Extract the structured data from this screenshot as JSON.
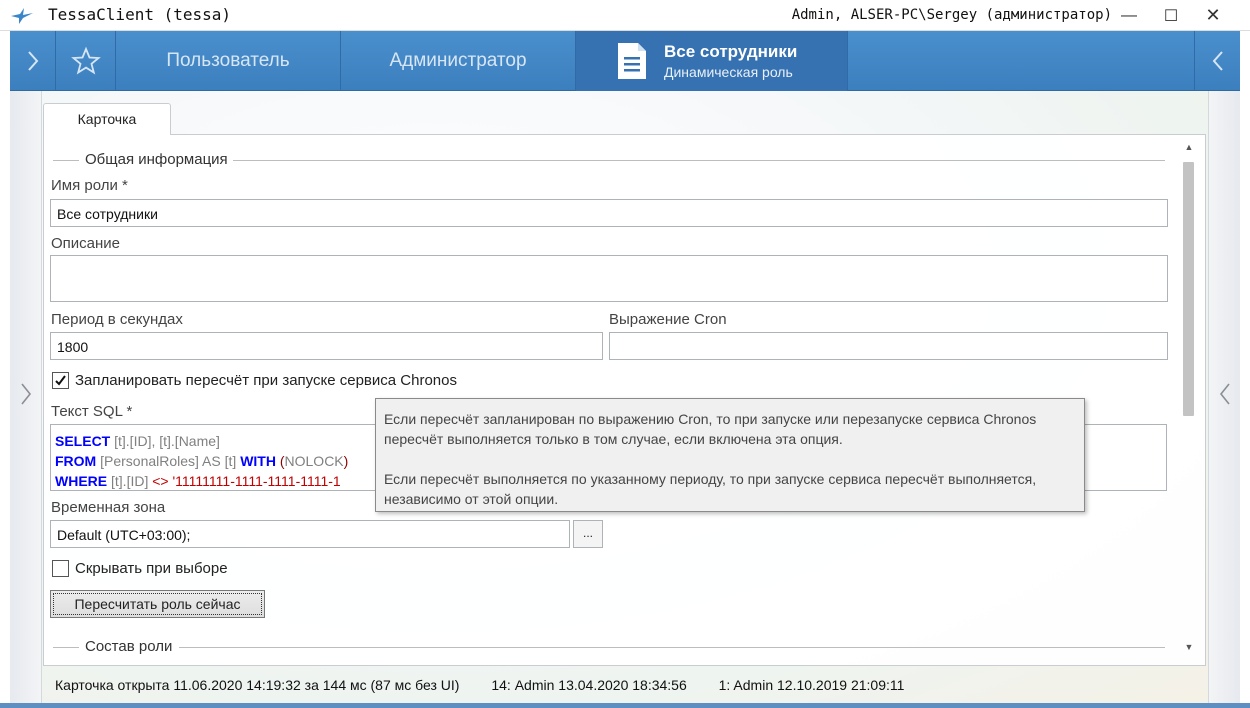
{
  "window": {
    "title": "TessaClient (tessa)",
    "user_info": "Admin, ALSER-PC\\Sergey (администратор)",
    "minimize": "—",
    "maximize": "☐",
    "close": "✕"
  },
  "tabstrip": {
    "left_chevron": "›",
    "right_chevron": "‹",
    "tabs": [
      {
        "label": "Пользователь"
      },
      {
        "label": "Администратор"
      }
    ],
    "active": {
      "title": "Все сотрудники",
      "subtitle": "Динамическая роль"
    }
  },
  "card": {
    "tab_label": "Карточка",
    "section_general": "Общая информация",
    "role_name_label": "Имя роли  *",
    "role_name_value": "Все сотрудники",
    "description_label": "Описание",
    "description_value": "",
    "period_label": "Период в секундах",
    "period_value": "1800",
    "cron_label": "Выражение Cron",
    "cron_value": "",
    "schedule_checkbox_label": "Запланировать пересчёт при запуске сервиса Chronos",
    "schedule_checked": true,
    "sql_label": "Текст SQL  *",
    "sql": {
      "line1": {
        "kw": "SELECT",
        "p1": " [t].[ID], [t].[Name]"
      },
      "line2": {
        "kw1": "FROM",
        "p1": " [PersonalRoles] AS [t] ",
        "kw2": "WITH",
        "p2": " (",
        "p3": "NOLOCK",
        "p4": ")"
      },
      "line3": {
        "kw": "WHERE",
        "p1": " [t].[ID] ",
        "op": "<>",
        "str": " '11111111-1111-1111-1111-1"
      }
    },
    "timezone_label": "Временная зона",
    "timezone_value": "Default (UTC+03:00);",
    "timezone_button": "...",
    "hide_checkbox_label": "Скрывать при выборе",
    "hide_checked": false,
    "recalc_button": "Пересчитать роль сейчас",
    "section_composition": "Состав роли"
  },
  "tooltip": {
    "para1": "Если пересчёт запланирован по выражению Cron, то при запуске или перезапуске сервиса Chronos пересчёт выполняется только в том случае, если включена эта опция.",
    "para2": "Если пересчёт выполняется по указанному периоду, то при запуске сервиса пересчёт выполняется, независимо от этой опции."
  },
  "status": {
    "opened": "Карточка открыта 11.06.2020 14:19:32 за 144 мс (87 мс без UI)",
    "version_current": "14:  Admin  13.04.2020 18:34:56",
    "version_first": "1:  Admin  12.10.2019 21:09:11"
  },
  "colors": {
    "tabstrip": "#4a8fcd",
    "active_tab": "#3672b1",
    "sql_keyword": "#0000ff",
    "sql_string": "#c00000"
  }
}
